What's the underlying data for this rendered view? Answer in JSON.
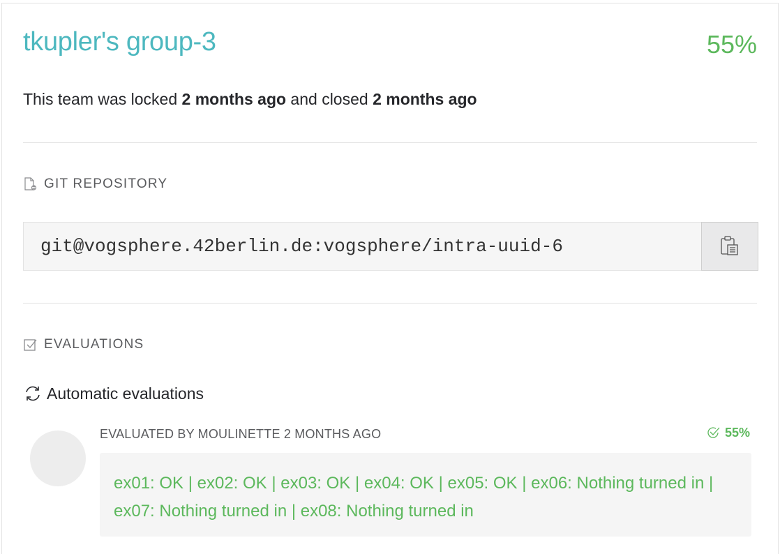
{
  "team": {
    "title": "tkupler's group-3",
    "score": "55%"
  },
  "status": {
    "prefix": "This team was locked ",
    "locked": "2 months ago",
    "middle": " and closed ",
    "closed": "2 months ago"
  },
  "git": {
    "heading": "GIT REPOSITORY",
    "url": "git@vogsphere.42berlin.de:vogsphere/intra-uuid-6",
    "icon": "git-file-icon",
    "copy_icon": "clipboard-icon"
  },
  "evaluations": {
    "heading": "EVALUATIONS",
    "icon": "checkbox-icon",
    "auto_title": "Automatic evaluations",
    "auto_icon": "refresh-icon",
    "items": [
      {
        "meta": "EVALUATED BY MOULINETTE 2 MONTHS AGO",
        "score": "55%",
        "result": "ex01: OK | ex02: OK | ex03: OK | ex04: OK | ex05: OK | ex06: Nothing turned in | ex07: Nothing turned in | ex08: Nothing turned in"
      }
    ]
  },
  "colors": {
    "title": "#4db8bf",
    "success": "#5cb85c"
  }
}
